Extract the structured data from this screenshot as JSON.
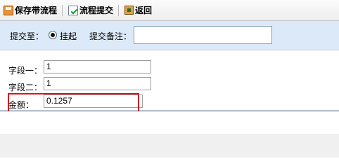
{
  "toolbar": {
    "save_label": "保存带流程",
    "submit_label": "流程提交",
    "back_label": "返回"
  },
  "submit_bar": {
    "target_label": "提交至：",
    "option_label": "挂起",
    "remark_label": "提交备注：",
    "remark_value": ""
  },
  "form": {
    "field1_label": "字段一：",
    "field1_value": "1",
    "field2_label": "字段二：",
    "field2_value": "1",
    "amount_label": "金额：",
    "amount_value": "0.1257"
  },
  "colors": {
    "highlight": "#d9141c",
    "submit_bar_bg": "#dce9f8"
  }
}
